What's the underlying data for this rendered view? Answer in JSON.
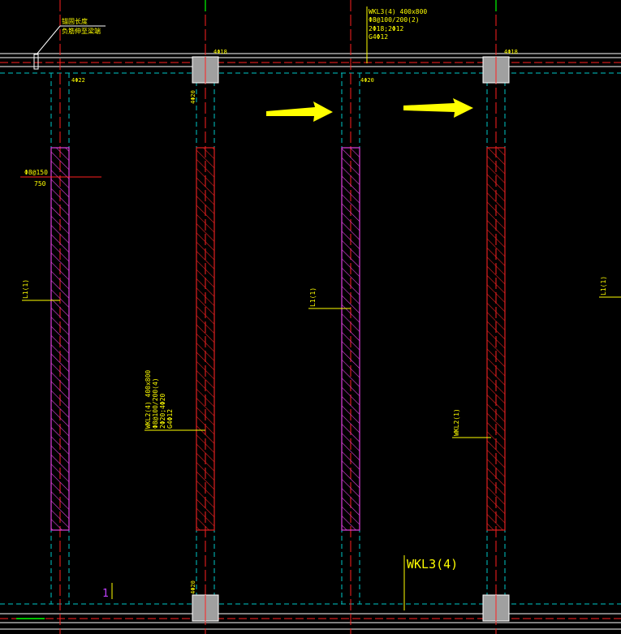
{
  "canvas": {
    "background": "#000000"
  },
  "colors": {
    "axis_red": "#ff2020",
    "beam_outline": "#ffffff",
    "dashed_cyan": "#00c8c8",
    "hatch_red": "#e02020",
    "hatch_magenta": "#e040e0",
    "text_yellow": "#ffff00",
    "column_gray": "#a0a0a0",
    "arrow_yellow": "#ffff00",
    "green_mark": "#00ff00"
  },
  "annotations": {
    "top_left_note_line1": "锚固长度",
    "top_left_note_line2": "负筋伸至梁端",
    "top_beam_name": "WKL3(4) 400x800",
    "top_beam_stirrup": "Φ8@100/200(2)",
    "top_beam_bars": "2Φ18;2Φ12",
    "top_beam_side": "G4Φ12",
    "rebar_4d18_left": "4Φ18",
    "rebar_4d18_right": "4Φ18",
    "rebar_4d22": "4Φ22",
    "rebar_4d20_mid": "4Φ20",
    "rebar_4d20_vertical_top": "4Φ20",
    "rebar_4d20_vertical_bottom": "4Φ20",
    "stirrup_left": "Φ8@150",
    "dim_750": "750",
    "l1_label_left": "L1(1)",
    "l1_label_mid": "L1(1)",
    "l1_label_right": "L1(1)",
    "wkl2_name": "WKL2(4) 400x800",
    "wkl2_stirrup": "Φ8@100/200(4)",
    "wkl2_bars": "2Φ20;4Φ20",
    "wkl2_side": "G4Φ12",
    "wkl2_small_label": "WKL2(1)",
    "wkl3_big_label": "WKL3(4)",
    "small_mark_1": "1"
  }
}
